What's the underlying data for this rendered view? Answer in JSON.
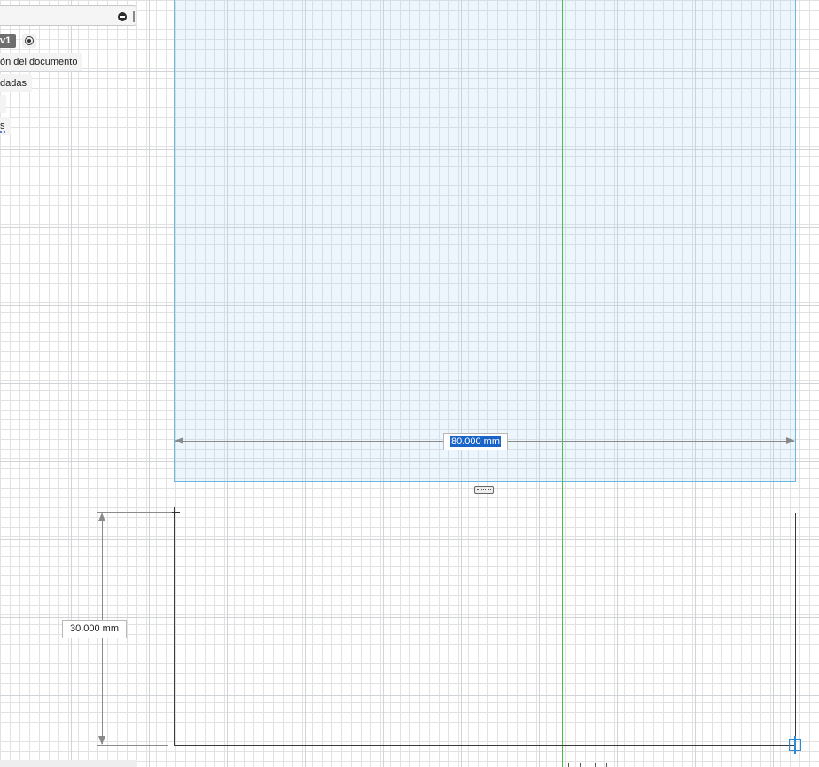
{
  "browser": {
    "component_tag": "v1",
    "items": [
      "ón del documento",
      "dadas",
      "s"
    ]
  },
  "dimensions": {
    "horizontal": "80.000 mm",
    "vertical": "30.000 mm"
  },
  "colors": {
    "sketch_plane_fill": "#e6f3fa",
    "sketch_plane_border": "#69b7df",
    "axis_y": "#48c048",
    "selection": "#1a63c9",
    "corner_marker": "#2a8bd9"
  },
  "icons": {
    "collapse": "minus-circle-icon",
    "pin": "pin-icon",
    "activate": "radio-target-icon",
    "constraint": "horizontal-constraint-icon",
    "corner": "sketch-point-icon"
  }
}
